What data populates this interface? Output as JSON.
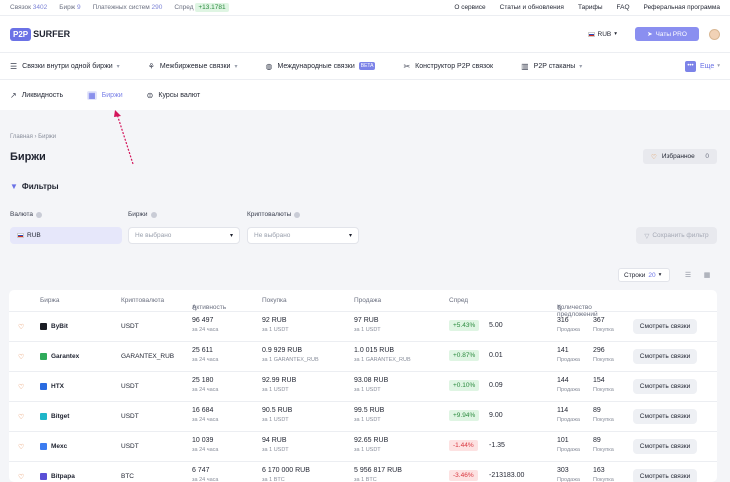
{
  "topbar": {
    "stats": [
      {
        "label": "Связок",
        "value": "3402"
      },
      {
        "label": "Бирж",
        "value": "9"
      },
      {
        "label": "Платежных систем",
        "value": "290"
      }
    ],
    "spread_label": "Спред",
    "spread_value": "+13.1781",
    "links": [
      "О сервисе",
      "Статьи и обновления",
      "Тарифы",
      "FAQ",
      "Реферальная программа"
    ]
  },
  "header": {
    "logo_p2p": "P2P",
    "logo_text": "SURFER",
    "currency": "RUB",
    "tg_button": "Чаты PRO"
  },
  "nav": {
    "items": [
      {
        "label": "Связки внутри одной биржи",
        "icon": "sliders-icon"
      },
      {
        "label": "Межбиржевые связки",
        "icon": "route-icon"
      },
      {
        "label": "Международные связки",
        "icon": "globe-icon",
        "badge": "BETA"
      },
      {
        "label": "Конструктор P2P связок",
        "icon": "tools-icon"
      },
      {
        "label": "P2P стаканы",
        "icon": "chart-icon"
      }
    ],
    "more": "Еще"
  },
  "subnav": {
    "items": [
      {
        "label": "Ликвидность",
        "icon": "trend-icon"
      },
      {
        "label": "Биржи",
        "icon": "bank-icon"
      },
      {
        "label": "Курсы валют",
        "icon": "exchange-icon"
      }
    ],
    "active_index": 1
  },
  "page": {
    "breadcrumb": "Главная  ›  Биржи",
    "title": "Биржи",
    "favorites_label": "Избранное",
    "favorites_count": "0"
  },
  "filters": {
    "title": "Фильтры",
    "currency_label": "Валюта",
    "currency_value": "RUB",
    "exchanges_label": "Биржи",
    "exchanges_value": "Не выбрано",
    "crypto_label": "Криптовалюты",
    "crypto_value": "Не выбрано",
    "save_button": "Сохранить фильтр"
  },
  "table_controls": {
    "rows_label": "Строки",
    "rows_value": "20"
  },
  "table": {
    "headers": [
      "Биржа",
      "Криптовалюта",
      "Активность",
      "Покупка",
      "Продажа",
      "Спред",
      "Количество предложений"
    ],
    "view_button": "Смотреть связки",
    "rows": [
      {
        "exchange": "ByBit",
        "logo_color": "#1a1d24",
        "crypto": "USDT",
        "activity": "96 497",
        "activity_sub": "за 24 часа",
        "buy": "92 RUB",
        "buy_sub": "за 1 USDT",
        "sell": "97 RUB",
        "sell_sub": "за 1 USDT",
        "spread_pct": "+5.43%",
        "spread_sign": "pos",
        "spread_val": "5.00",
        "offers_buy": "316",
        "offers_buy_sub": "Продажа",
        "offers_sell": "367",
        "offers_sell_sub": "Покупка"
      },
      {
        "exchange": "Garantex",
        "logo_color": "#2faa5a",
        "crypto": "GARANTEX_RUB",
        "activity": "25 611",
        "activity_sub": "за 24 часа",
        "buy": "0.9 929 RUB",
        "buy_sub": "за 1 GARANTEX_RUB",
        "sell": "1.0 015 RUB",
        "sell_sub": "за 1 GARANTEX_RUB",
        "spread_pct": "+0.87%",
        "spread_sign": "pos",
        "spread_val": "0.01",
        "offers_buy": "141",
        "offers_buy_sub": "Продажа",
        "offers_sell": "296",
        "offers_sell_sub": "Покупка"
      },
      {
        "exchange": "HTX",
        "logo_color": "#2a6be0",
        "crypto": "USDT",
        "activity": "25 180",
        "activity_sub": "за 24 часа",
        "buy": "92.99 RUB",
        "buy_sub": "за 1 USDT",
        "sell": "93.08 RUB",
        "sell_sub": "за 1 USDT",
        "spread_pct": "+0.10%",
        "spread_sign": "pos",
        "spread_val": "0.09",
        "offers_buy": "144",
        "offers_buy_sub": "Продажа",
        "offers_sell": "154",
        "offers_sell_sub": "Покупка"
      },
      {
        "exchange": "Bitget",
        "logo_color": "#1fb6c9",
        "crypto": "USDT",
        "activity": "16 684",
        "activity_sub": "за 24 часа",
        "buy": "90.5 RUB",
        "buy_sub": "за 1 USDT",
        "sell": "99.5 RUB",
        "sell_sub": "за 1 USDT",
        "spread_pct": "+9.94%",
        "spread_sign": "pos",
        "spread_val": "9.00",
        "offers_buy": "114",
        "offers_buy_sub": "Продажа",
        "offers_sell": "89",
        "offers_sell_sub": "Покупка"
      },
      {
        "exchange": "Mexc",
        "logo_color": "#3c7cf0",
        "crypto": "USDT",
        "activity": "10 039",
        "activity_sub": "за 24 часа",
        "buy": "94 RUB",
        "buy_sub": "за 1 USDT",
        "sell": "92.65 RUB",
        "sell_sub": "за 1 USDT",
        "spread_pct": "-1.44%",
        "spread_sign": "neg",
        "spread_val": "-1.35",
        "offers_buy": "101",
        "offers_buy_sub": "Продажа",
        "offers_sell": "89",
        "offers_sell_sub": "Покупка"
      },
      {
        "exchange": "Bitpapa",
        "logo_color": "#5a4fd6",
        "crypto": "BTC",
        "activity": "6 747",
        "activity_sub": "за 24 часа",
        "buy": "6 170 000 RUB",
        "buy_sub": "за 1 BTC",
        "sell": "5 956 817 RUB",
        "sell_sub": "за 1 BTC",
        "spread_pct": "-3.46%",
        "spread_sign": "neg",
        "spread_val": "-213183.00",
        "offers_buy": "303",
        "offers_buy_sub": "Продажа",
        "offers_sell": "163",
        "offers_sell_sub": "Покупка"
      }
    ]
  }
}
